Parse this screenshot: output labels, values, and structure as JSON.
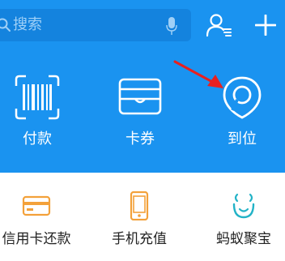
{
  "header": {
    "search_placeholder": "搜索"
  },
  "top_actions": [
    {
      "label": "付款",
      "icon": "barcode-scan-icon"
    },
    {
      "label": "卡券",
      "icon": "card-wallet-icon"
    },
    {
      "label": "到位",
      "icon": "location-pin-icon"
    }
  ],
  "bottom_items": [
    {
      "label": "信用卡还款",
      "icon": "credit-card-icon"
    },
    {
      "label": "手机充值",
      "icon": "mobile-phone-icon"
    },
    {
      "label": "蚂蚁聚宝",
      "icon": "ant-fortune-icon"
    }
  ],
  "annotation": {
    "arrow_color": "#e8201f"
  },
  "colors": {
    "header_bg": "#1a93f0",
    "search_bg": "#1483de",
    "orange_icon": "#f3a13a",
    "teal_icon": "#23b3c7"
  }
}
